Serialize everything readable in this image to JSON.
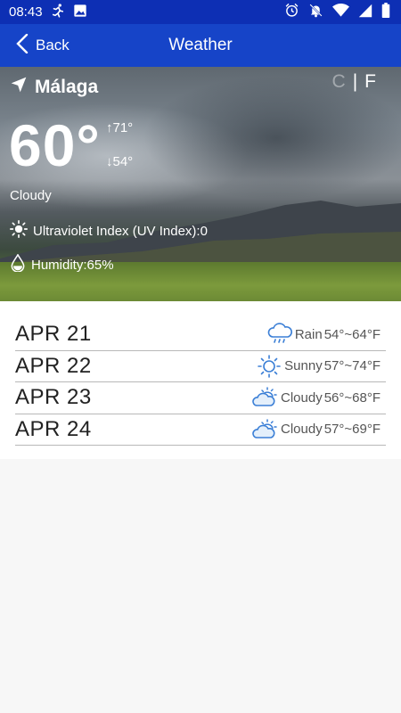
{
  "status_bar": {
    "time": "08:43",
    "left_icons": [
      "running-person-icon",
      "image-icon"
    ],
    "right_icons": [
      "alarm-icon",
      "notifications-off-icon",
      "wifi-icon",
      "cell-signal-icon",
      "battery-icon"
    ]
  },
  "nav": {
    "back_label": "Back",
    "title": "Weather"
  },
  "current": {
    "location": "Málaga",
    "unit_c": "C",
    "unit_sep": "|",
    "unit_f": "F",
    "temperature": "60°",
    "high": "71°",
    "low": "54°",
    "condition": "Cloudy",
    "uv_text": "Ultraviolet Index (UV Index):0",
    "humidity_text": "Humidity:65%"
  },
  "forecast": [
    {
      "date": "APR 21",
      "icon": "rain-cloud-icon",
      "condition": "Rain",
      "range": "54°~64°F"
    },
    {
      "date": "APR 22",
      "icon": "sun-icon",
      "condition": "Sunny",
      "range": "57°~74°F"
    },
    {
      "date": "APR 23",
      "icon": "partly-cloudy-icon",
      "condition": "Cloudy",
      "range": "56°~68°F"
    },
    {
      "date": "APR 24",
      "icon": "partly-cloudy-icon",
      "condition": "Cloudy",
      "range": "57°~69°F"
    }
  ],
  "colors": {
    "status_bar": "#0d2fb4",
    "nav_bar": "#1644c8",
    "forecast_icon": "#3b7fd6"
  }
}
